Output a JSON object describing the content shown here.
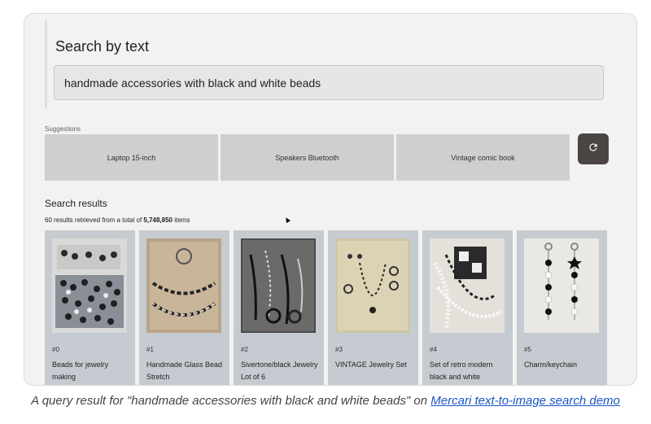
{
  "search": {
    "title": "Search by text",
    "query": "handmade accessories with black and white beads"
  },
  "suggestions": {
    "label": "Suggestions",
    "items": [
      "Laptop 15-inch",
      "Speakers Bluetooth",
      "Vintage comic book"
    ],
    "refresh_icon": "refresh-icon"
  },
  "results": {
    "title": "Search results",
    "count_prefix": "60 results retrieved from a total of",
    "total": "5,748,850",
    "count_suffix": "items",
    "items": [
      {
        "rank": "#0",
        "title": "Beads for jewelry making"
      },
      {
        "rank": "#1",
        "title": "Handmade Glass Bead Stretch"
      },
      {
        "rank": "#2",
        "title": "Sivertone/black Jewelry Lot of 6"
      },
      {
        "rank": "#3",
        "title": "VINTAGE Jewelry Set"
      },
      {
        "rank": "#4",
        "title": "Set of retro modern black and white"
      },
      {
        "rank": "#5",
        "title": "Charm/keychain"
      }
    ]
  },
  "caption": {
    "prefix": "A query result for \"handmade accessories with black and white beads\" on",
    "link": "Mercari text-to-image search demo"
  }
}
